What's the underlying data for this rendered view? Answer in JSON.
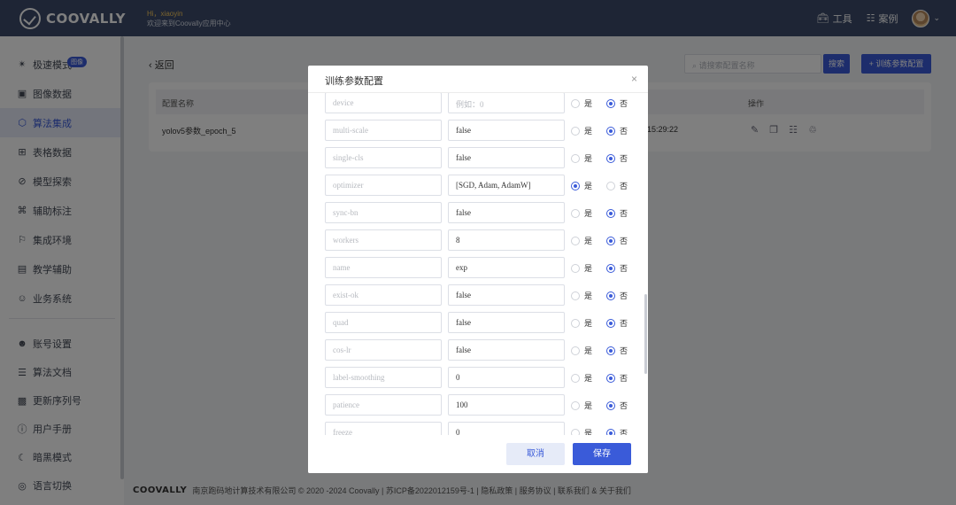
{
  "header": {
    "logo_text": "COOVALLY",
    "greeting": "Hi，xiaoyin",
    "welcome": "欢迎来到Coovally应用中心",
    "tools_label": "工具",
    "cases_label": "案例"
  },
  "sidebar": {
    "items": [
      {
        "label": "极速模式",
        "icon": "rocket-icon",
        "badge": "图像"
      },
      {
        "label": "图像数据",
        "icon": "image-icon"
      },
      {
        "label": "算法集成",
        "icon": "cube-icon",
        "active": true
      },
      {
        "label": "表格数据",
        "icon": "table-icon"
      },
      {
        "label": "模型探索",
        "icon": "compass-icon"
      },
      {
        "label": "辅助标注",
        "icon": "annotate-icon"
      },
      {
        "label": "集成环境",
        "icon": "flag-icon"
      },
      {
        "label": "教学辅助",
        "icon": "teach-icon"
      },
      {
        "label": "业务系统",
        "icon": "people-icon"
      }
    ],
    "bottom_items": [
      {
        "label": "账号设置",
        "icon": "user-icon"
      },
      {
        "label": "算法文档",
        "icon": "doc-icon"
      },
      {
        "label": "更新序列号",
        "icon": "serial-icon"
      },
      {
        "label": "用户手册",
        "icon": "help-icon"
      },
      {
        "label": "暗黑模式",
        "icon": "moon-icon"
      },
      {
        "label": "语言切换",
        "icon": "globe-icon"
      }
    ]
  },
  "main": {
    "back_label": "返回",
    "search_placeholder": "请搜索配置名称",
    "search_button": "搜索",
    "add_button": "+ 训练参数配置",
    "table": {
      "col_name": "配置名称",
      "col_ops": "操作",
      "row_name": "yolov5参数_epoch_5",
      "row_time": "15:29:22"
    }
  },
  "footer": {
    "logo": "COOVALLY",
    "text": "南京跑码地计算技术有限公司 © 2020 -2024 Coovally | 苏ICP备2022012159号-1 | 隐私政策 | 服务协议 | 联系我们 & 关于我们"
  },
  "modal": {
    "title": "训练参数配置",
    "yes_label": "是",
    "no_label": "否",
    "cancel_label": "取消",
    "save_label": "保存",
    "params": [
      {
        "name": "device",
        "value": "",
        "value_placeholder": "例如：0",
        "selected": "no"
      },
      {
        "name": "multi-scale",
        "value": "false",
        "selected": "no"
      },
      {
        "name": "single-cls",
        "value": "false",
        "selected": "no"
      },
      {
        "name": "optimizer",
        "value": "[SGD, Adam, AdamW]",
        "selected": "yes"
      },
      {
        "name": "sync-bn",
        "value": "false",
        "selected": "no"
      },
      {
        "name": "workers",
        "value": "8",
        "selected": "no"
      },
      {
        "name": "name",
        "value": "exp",
        "selected": "no"
      },
      {
        "name": "exist-ok",
        "value": "false",
        "selected": "no"
      },
      {
        "name": "quad",
        "value": "false",
        "selected": "no"
      },
      {
        "name": "cos-lr",
        "value": "false",
        "selected": "no"
      },
      {
        "name": "label-smoothing",
        "value": "0",
        "selected": "no"
      },
      {
        "name": "patience",
        "value": "100",
        "selected": "no"
      },
      {
        "name": "freeze",
        "value": "0",
        "selected": "no"
      }
    ]
  },
  "colors": {
    "header_bg": "#3c4b6a",
    "accent": "#3a5bd9"
  }
}
